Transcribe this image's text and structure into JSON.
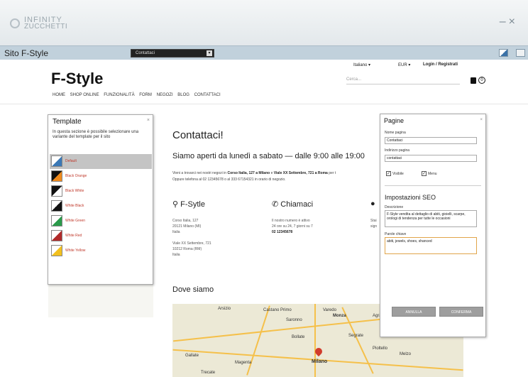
{
  "app": {
    "logo_line1": "INFINITY",
    "logo_line2": "ZUCCHETTI",
    "window_controls": "–×"
  },
  "sitebar": {
    "title": "Sito F-Style",
    "page_select_value": "Contattaci"
  },
  "site": {
    "brand": "F-Style",
    "nav": [
      "HOME",
      "SHOP ONLINE",
      "FUNZIONALITÀ",
      "FORM",
      "NEGOZI",
      "BLOG",
      "CONTATTACI"
    ],
    "language": "Italiano ▾",
    "currency": "EUR ▾",
    "login": "Login / Registrati",
    "search_placeholder": "Cerca...",
    "cart_count": "0"
  },
  "template_panel": {
    "title": "Template",
    "close": "×",
    "description": "In questa sezione è possibile selezionare una variante del template per il sito",
    "items": [
      {
        "label": "Default",
        "c1": "#ffffff",
        "c2": "#3b78b5"
      },
      {
        "label": "Black Orange",
        "c1": "#111111",
        "c2": "#f08a1c"
      },
      {
        "label": "Black White",
        "c1": "#111111",
        "c2": "#ffffff"
      },
      {
        "label": "White Black",
        "c1": "#ffffff",
        "c2": "#111111"
      },
      {
        "label": "White Green",
        "c1": "#ffffff",
        "c2": "#2a9a4a"
      },
      {
        "label": "White Red",
        "c1": "#ffffff",
        "c2": "#b02a2a"
      },
      {
        "label": "White Yellow",
        "c1": "#ffffff",
        "c2": "#f2c01e"
      }
    ]
  },
  "content": {
    "h1": "Contattaci!",
    "h2": "Siamo aperti da lunedì a sabato — dalle 9:00 alle 19:00",
    "intro_line1_a": "Vieni a trovarci nei nostri negozi in ",
    "intro_line1_b": "Corso Italia, 127 a Milano",
    "intro_line1_c": " e ",
    "intro_line1_d": "Viale XX Settembre, 721 a Roma",
    "intro_line1_e": " per t",
    "intro_line2": "Oppure telefona al 02 12345678 o al 333 67154321 in orario di negozio.",
    "col1_title": "F-Sytle",
    "col1_lines": [
      "Corso Italia, 127",
      "20121 Milano (MI)",
      "Italia",
      "",
      "Viale XX Settembre, 721",
      "10212 Roma (RM)",
      "Italia"
    ],
    "col2_title": "Chiamaci",
    "col2_lines": [
      "Il nostro numero è attivo",
      "24 ore su 24, 7 giorni su 7",
      "02 12345678"
    ],
    "col3_line1": "Stai",
    "col3_line2": "sign",
    "map_title": "Dove siamo",
    "map_labels": [
      "Arsizio",
      "Castano Primo",
      "Varedo",
      "Monza",
      "Agrate",
      "Saronno",
      "Gallate",
      "Magenta",
      "Milano",
      "Pioltello",
      "Melzo",
      "Trecate",
      "Bollate",
      "Segrate"
    ]
  },
  "pagine_panel": {
    "title": "Pagine",
    "close": "×",
    "nome_label": "Nome pagina",
    "nome_value": "Contattaci",
    "indirizzo_label": "Indirizzo pagina",
    "indirizzo_value": "contattaci",
    "visibile_label": "Visibile",
    "menu_label": "Menu",
    "seo_title": "Impostazioni SEO",
    "descrizione_label": "Descrizione",
    "descrizione_value": "F-Style vendita al dettaglio di abiti, gioielli, scarpe, orologi di tendenza per tutte le occasioni",
    "parole_label": "Parole chiave",
    "parole_value": "abiti, jewels, shoes, shanced",
    "annulla_label": "ANNULLA",
    "conferma_label": "CONFERMA"
  }
}
